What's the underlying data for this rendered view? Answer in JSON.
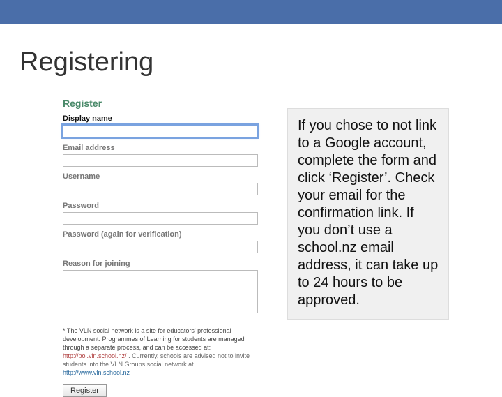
{
  "slide": {
    "title": "Registering"
  },
  "form": {
    "header": "Register",
    "labels": {
      "display_name": "Display name",
      "email": "Email address",
      "username": "Username",
      "password": "Password",
      "password2": "Password (again for verification)",
      "reason": "Reason for joining"
    },
    "footnote": {
      "line1": "* The VLN social network is a site for educators' professional development. Programmes of Learning for students are managed through a separate process, and can be accessed at:",
      "link1": "http://pol.vln.school.nz/",
      "line2": ". Currently, schools are advised not to invite students into the VLN Groups social network at",
      "link2": "http://www.vln.school.nz"
    },
    "button": "Register"
  },
  "callout": {
    "text": "If you chose to not link to a Google account, complete the form and click ‘Register’.  Check your email for the confirmation link. If you don’t use a school.nz email address, it can take up to 24 hours to be approved."
  }
}
